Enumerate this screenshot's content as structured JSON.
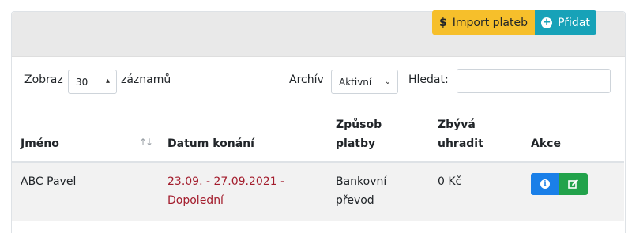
{
  "toolbar": {
    "import_label": "Import plateb",
    "add_label": "Přidat",
    "import_icon": "dollar-icon",
    "add_icon": "plus-circle-icon",
    "import_color": "#f6bf2b",
    "add_color": "#17a2b8"
  },
  "filters": {
    "show_prefix": "Zobraz",
    "show_value": "30",
    "show_suffix": "záznamů",
    "archive_label": "Archív",
    "archive_value": "Aktivní",
    "search_label": "Hledat:",
    "search_value": ""
  },
  "table": {
    "headers": {
      "name": "Jméno",
      "date": "Datum konání",
      "payment_line1": "Způsob",
      "payment_line2": "platby",
      "remaining_line1": "Zbývá",
      "remaining_line2": "uhradit",
      "actions": "Akce"
    },
    "rows": [
      {
        "name": "ABC Pavel",
        "date_line1": "23.09. - 27.09.2021 -",
        "date_line2": "Dopolední",
        "payment_line1": "Bankovní",
        "payment_line2": "převod",
        "remaining": "0 Kč"
      }
    ]
  }
}
